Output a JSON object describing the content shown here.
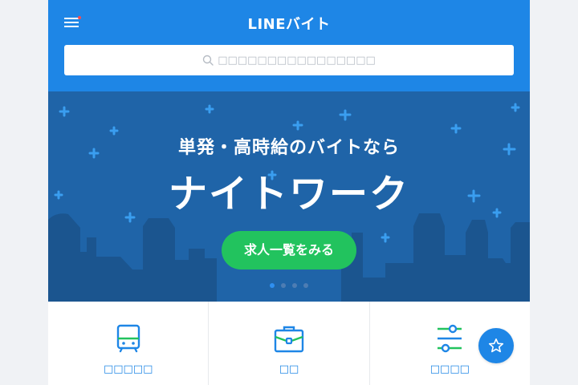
{
  "header": {
    "logo": "LINEバイト",
    "menu_icon": "hamburger-menu-icon",
    "notification_dot_color": "#ff4a4a",
    "background": "#1e86e6"
  },
  "search": {
    "placeholder": "□□□□□□□□□□□□□□□□",
    "icon": "search-icon"
  },
  "banner": {
    "subtitle": "単発・高時給のバイトなら",
    "title": "ナイトワーク",
    "cta_label": "求人一覧をみる",
    "cta_color": "#22c35e",
    "slide_count": 4,
    "active_slide": 1
  },
  "categories": [
    {
      "label": "□□□□□",
      "icon": "train-icon"
    },
    {
      "label": "□□",
      "icon": "briefcase-icon"
    },
    {
      "label": "□□□□",
      "icon": "filter-sliders-icon"
    }
  ],
  "fab": {
    "icon": "star-icon"
  }
}
